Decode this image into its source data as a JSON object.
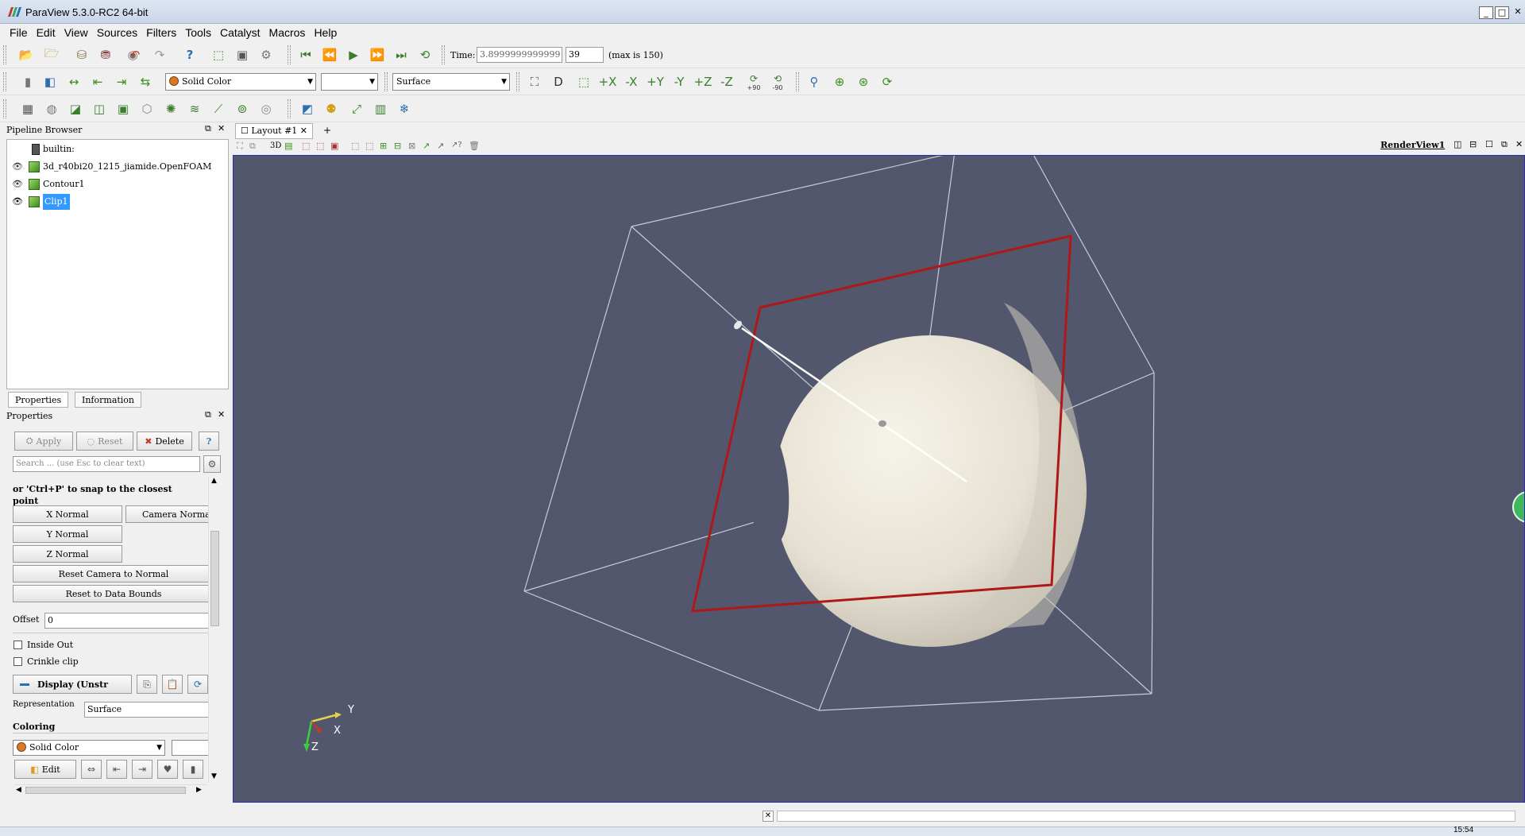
{
  "window": {
    "title": "ParaView 5.3.0-RC2 64-bit"
  },
  "menu": [
    "File",
    "Edit",
    "View",
    "Sources",
    "Filters",
    "Tools",
    "Catalyst",
    "Macros",
    "Help"
  ],
  "time": {
    "label": "Time:",
    "value": "3.8999999999999",
    "step": "39",
    "max_text": "(max is 150)"
  },
  "toolbar2": {
    "coloring": "Solid Color",
    "component": "",
    "representation": "Surface",
    "rotate_plus": "+90",
    "rotate_minus": "-90"
  },
  "pipeline": {
    "title": "Pipeline Browser",
    "items": [
      {
        "label": "builtin:"
      },
      {
        "label": "3d_r40bi20_1215_jiamide.OpenFOAM"
      },
      {
        "label": "Contour1"
      },
      {
        "label": "Clip1"
      }
    ]
  },
  "tabs": {
    "properties": "Properties",
    "information": "Information"
  },
  "properties": {
    "title": "Properties",
    "apply": "Apply",
    "reset": "Reset",
    "delete": "Delete",
    "help": "?",
    "search_placeholder": "Search ... (use Esc to clear text)",
    "hint_line1": "or 'Ctrl+P' to snap to the closest",
    "hint_line2": "point",
    "x_normal": "X Normal",
    "camera_normal": "Camera Normal",
    "y_normal": "Y Normal",
    "z_normal": "Z Normal",
    "reset_camera": "Reset Camera to Normal",
    "reset_bounds": "Reset to Data Bounds",
    "offset_label": "Offset",
    "offset_value": "0",
    "inside_out": "Inside Out",
    "crinkle_clip": "Crinkle clip",
    "display_section": "Display (Unstr",
    "representation_label": "Representation",
    "representation_value": "Surface",
    "coloring_label": "Coloring",
    "coloring_value": "Solid Color",
    "edit": "Edit"
  },
  "layout": {
    "tab": "Layout #1",
    "add": "+",
    "view_name": "RenderView1",
    "mode_3d": "3D"
  },
  "axes": {
    "y": "Y",
    "x": "X",
    "z": "Z"
  },
  "colors": {
    "render_background": "#52576d",
    "plane_outline": "#b01818",
    "selection": "#3399ff",
    "accent_green": "#3c8e1a",
    "swatch_orange": "#d97a26"
  },
  "status": {
    "close": "✕"
  },
  "taskbar": {
    "clock": "15:54"
  }
}
